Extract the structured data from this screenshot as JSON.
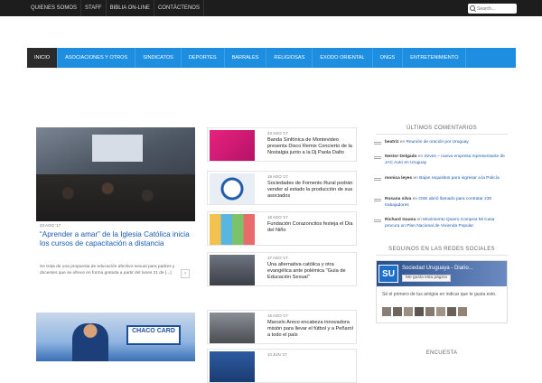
{
  "topnav": {
    "items": [
      "QUIENES SOMOS",
      "STAFF",
      "BIBLIA ON-LINE",
      "CONTÁCTENOS"
    ]
  },
  "search": {
    "placeholder": "Search..."
  },
  "mainnav": {
    "items": [
      "INICIO",
      "ASOCIACIONES Y OTROS",
      "SINDICATOS",
      "DEPORTES",
      "BARRALES",
      "RELIGIOSAS",
      "EXODO ORIENTAL",
      "ONGS",
      "ENTRETENIMIENTO"
    ]
  },
  "feature": {
    "date": "23 AGO '17",
    "title": "“Aprender a amar” de la Iglesia Católica inicia los cursos de capacitación a distancia",
    "excerpt": "Se trata de una propuesta de educación afectivo-sexual para padres y docentes que se ofrece en forma gratuita a partir del lunes 21 de [...]"
  },
  "feature2": {
    "sign": "CHACO CARD"
  },
  "list": [
    {
      "date": "23 AGO '17",
      "title": "Banda Sinfónica de Montevideo presenta Disco Remix Concierto de la Nostalgia junto a la Dj Paola Dalto"
    },
    {
      "date": "19 AGO '17",
      "title": "Sociedades de Fomento Rural podrán vender al estado la producción de sus asociados"
    },
    {
      "date": "18 AGO '17",
      "title": "Fundación Corazoncitos festeja el Día del Niño"
    },
    {
      "date": "17 AGO '17",
      "title": "Una alternativa católica y otra evangélica ante polémica \"Guía de Educación Sexual\""
    },
    {
      "date": "16 AGO '17",
      "title": "Marcelo Areco encabeza innovadora misión para llevar el fútbol y a Peñarol a todo el país"
    },
    {
      "date": "10 JUN '17",
      "title": ""
    }
  ],
  "sidebar": {
    "comments_title": "ÚLTIMOS COMENTARIOS",
    "comments": [
      {
        "author": "beatriz",
        "on": "en",
        "post": "Reunión de oración por Uruguay"
      },
      {
        "author": "Nestor Delgado",
        "on": "en",
        "post": "Seves – nueva empresa representante de JAC Auto en Uruguay"
      },
      {
        "author": "monica leyes",
        "on": "en",
        "post": "Bajan requisitos para ingresar a la Policía"
      },
      {
        "author": "Rosana silva",
        "on": "en",
        "post": "OSE abrió llamado para contratar 230 trabajadores"
      },
      {
        "author": "Richard Gauna",
        "on": "en",
        "post": "Movimiento Quiero Comprar Mi Casa procura un Plan Nacional de Vivienda Popular"
      }
    ],
    "social_title": "SEGUINOS EN LAS REDES SOCIALES",
    "fb": {
      "logo": "SU",
      "name": "Sociedad Uruguaya - Diario...",
      "like": "Me gusta esta página",
      "text": "Sé el primero de tus amigos en indicar que te gusta esto."
    },
    "poll_title": "ENCUESTA"
  }
}
